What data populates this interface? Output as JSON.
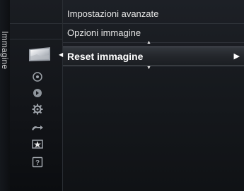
{
  "sidebar": {
    "title": "Immagine",
    "icons": [
      {
        "name": "picture-icon",
        "selected": true
      },
      {
        "name": "sound-icon"
      },
      {
        "name": "channel-icon"
      },
      {
        "name": "setup-icon"
      },
      {
        "name": "input-icon"
      },
      {
        "name": "application-icon"
      },
      {
        "name": "support-icon"
      }
    ]
  },
  "menu": {
    "items": [
      {
        "label": "Impostazioni avanzate"
      },
      {
        "label": "Opzioni immagine"
      },
      {
        "label": "Reset immagine",
        "selected": true,
        "arrow": "▶"
      }
    ],
    "scroll_up": "▲",
    "scroll_down": "▼",
    "left_arrow": "◀"
  },
  "colors": {
    "background": "#07090c",
    "text": "#e6e6e6",
    "selected_text": "#ffffff"
  }
}
